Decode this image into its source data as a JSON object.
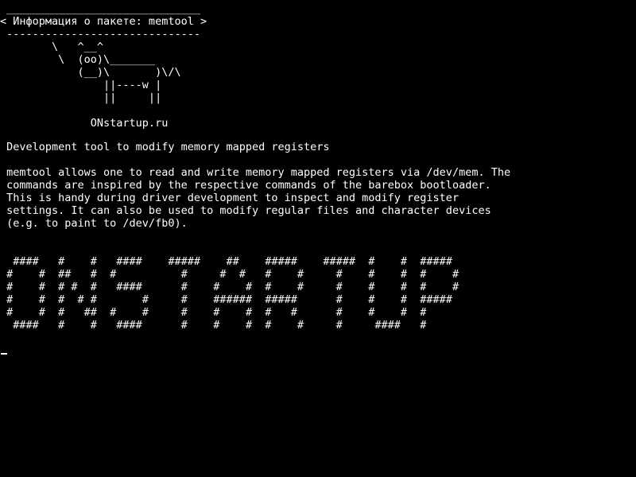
{
  "cowsay": {
    "text": " ______________________________\n< Информация о пакете: memtool >\n ------------------------------\n        \\   ^__^\n         \\  (oo)\\_______\n            (__)\\       )\\/\\\n                ||----w |\n                ||     ||\n\n              ONstartup.ru"
  },
  "package": {
    "summary": " Development tool to modify memory mapped registers",
    "description": " memtool allows one to read and write memory mapped registers via /dev/mem. The\n commands are inspired by the respective commands of the barebox bootloader.\n This is handy during driver development to inspect and modify register\n settings. It can also be used to modify regular files and character devices\n (e.g. to paint to /dev/fb0)."
  },
  "banner": {
    "text": "  ####   #    #   ####    #####    ##    #####    #####  #    #  #####\n #    #  ##   #  #          #     #  #   #    #     #    #    #  #    #\n #    #  # #  #   ####      #    #    #  #    #     #    #    #  #    #\n #    #  #  # #       #     #    ######  #####      #    #    #  #####\n #    #  #   ##  #    #     #    #    #  #   #      #    #    #  #\n  ####   #    #   ####      #    #    #  #    #     #     ####   #"
  }
}
